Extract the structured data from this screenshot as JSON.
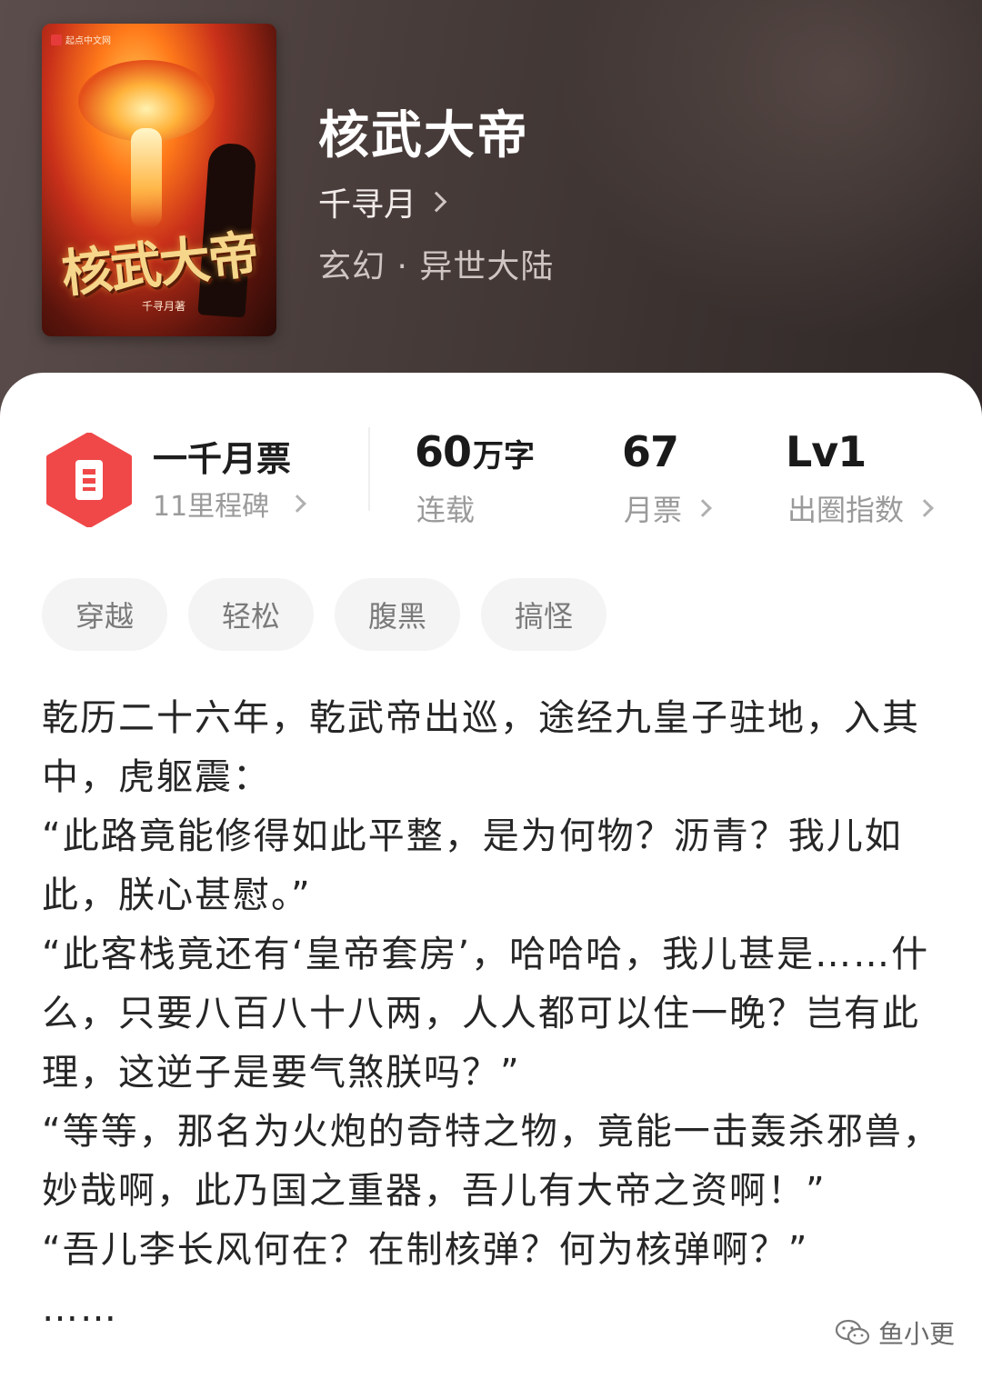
{
  "book": {
    "title": "核武大帝",
    "author": "千寻月",
    "genre": "玄幻 · 异世大陆"
  },
  "cover": {
    "publisher": "起点中文网",
    "title": "核武大帝",
    "author": "千寻月著"
  },
  "stats": {
    "milestone_title": "一千月票",
    "milestone_sub": "11里程碑",
    "word_count_value": "60",
    "word_count_unit": "万字",
    "word_count_label": "连载",
    "monthly_votes_value": "67",
    "monthly_votes_label": "月票",
    "level_value": "Lv1",
    "level_label": "出圈指数"
  },
  "tags": [
    "穿越",
    "轻松",
    "腹黑",
    "搞怪"
  ],
  "description": [
    "乾历二十六年，乾武帝出巡，途经九皇子驻地，入其中，虎躯震：",
    "“此路竟能修得如此平整，是为何物？沥青？我儿如此，朕心甚慰。”",
    "“此客栈竟还有‘皇帝套房’，哈哈哈，我儿甚是……什么，只要八百八十八两，人人都可以住一晚？岂有此理，这逆子是要气煞朕吗？”",
    "“等等，那名为火炮的奇特之物，竟能一击轰杀邪兽，妙哉啊，此乃国之重器，吾儿有大帝之资啊！”",
    "“吾儿李长风何在？在制核弹？何为核弹啊？”",
    "……"
  ],
  "watermark": "鱼小更",
  "colors": {
    "accent_red": "#f04848",
    "hero_bg": "#4a3e3c"
  }
}
